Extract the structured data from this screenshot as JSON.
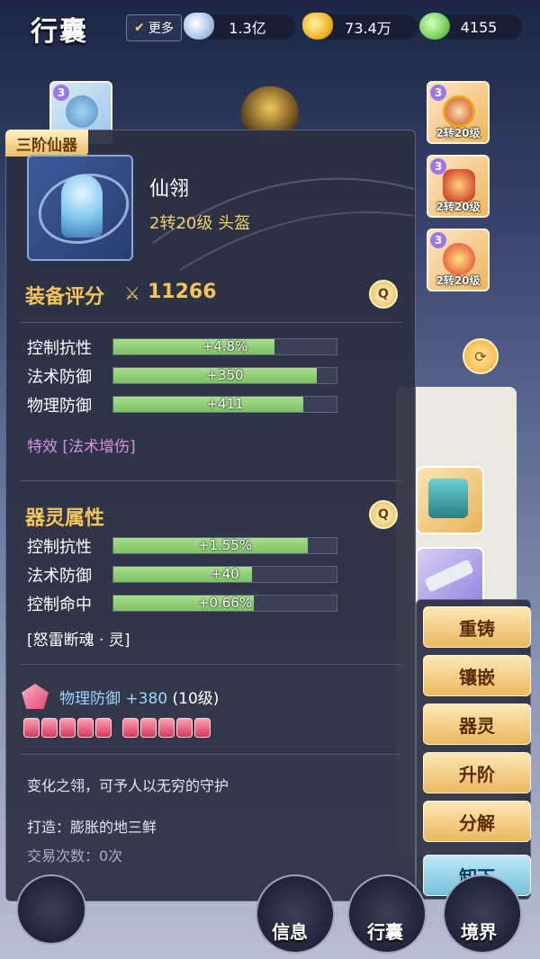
{
  "header": {
    "title": "行囊",
    "more_label": "更多",
    "currencies": [
      {
        "icon": "silver-ingot-icon",
        "value": "1.3亿"
      },
      {
        "icon": "gold-ingot-icon",
        "value": "73.4万"
      },
      {
        "icon": "jade-coin-icon",
        "value": "4155"
      }
    ]
  },
  "equipment_slots": {
    "left": {
      "badge": "3",
      "icon": "helmet-icon"
    },
    "right": [
      {
        "badge": "3",
        "level": "2转20级",
        "icon": "necklace-icon"
      },
      {
        "badge": "3",
        "level": "2转20级",
        "icon": "armor-icon"
      },
      {
        "badge": "3",
        "level": "2转20级",
        "icon": "belt-icon"
      }
    ]
  },
  "detail": {
    "tier_label": "三阶仙器",
    "item_name": "仙翎",
    "item_sub": "2转20级 头盔",
    "score_title": "装备评分",
    "score_value": "11266",
    "base_stats": [
      {
        "label": "控制抗性",
        "value": "+4.8%",
        "fill": 0.72
      },
      {
        "label": "法术防御",
        "value": "+350",
        "fill": 0.91
      },
      {
        "label": "物理防御",
        "value": "+411",
        "fill": 0.85
      }
    ],
    "effect": "特效 [法术增伤]",
    "spirit_title": "器灵属性",
    "spirit_stats": [
      {
        "label": "控制抗性",
        "value": "+1.55%",
        "fill": 0.87
      },
      {
        "label": "法术防御",
        "value": "+40",
        "fill": 0.62
      },
      {
        "label": "控制命中",
        "value": "+0.66%",
        "fill": 0.63
      }
    ],
    "spirit_name": "[怒雷断魂 · 灵]",
    "gem_attr": "物理防御",
    "gem_value": "+380",
    "gem_level": "(10级)",
    "description": "变化之翎，可予人以无穷的守护",
    "maker": "打造：膨胀的地三鲜",
    "trade_count": "交易次数：0次"
  },
  "actions": [
    "重铸",
    "镶嵌",
    "器灵",
    "升阶",
    "分解",
    "卸下"
  ],
  "nav": [
    "信息",
    "行囊",
    "境界"
  ]
}
